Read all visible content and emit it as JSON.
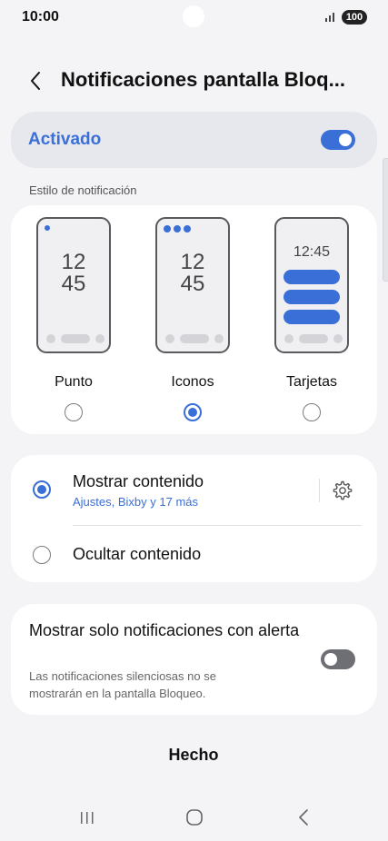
{
  "status_bar": {
    "time": "10:00",
    "battery": "100"
  },
  "header": {
    "title": "Notificaciones pantalla Bloq..."
  },
  "master_toggle": {
    "label": "Activado",
    "state": "on"
  },
  "style_section": {
    "label": "Estilo de notificación",
    "options": [
      {
        "label": "Punto",
        "clock_hour": "12",
        "clock_min": "45",
        "selected": false
      },
      {
        "label": "Iconos",
        "clock_hour": "12",
        "clock_min": "45",
        "selected": true
      },
      {
        "label": "Tarjetas",
        "clock": "12:45",
        "selected": false
      }
    ]
  },
  "content_section": {
    "show": {
      "label": "Mostrar contenido",
      "sublabel": "Ajustes, Bixby y 17 más",
      "selected": true
    },
    "hide": {
      "label": "Ocultar contenido",
      "selected": false
    }
  },
  "alert_section": {
    "title": "Mostrar solo notificaciones con alerta",
    "description": "Las notificaciones silenciosas no se mostrarán en la pantalla Bloqueo.",
    "state": "off"
  },
  "done_label": "Hecho",
  "colors": {
    "accent": "#3a6fd8",
    "background": "#f4f4f6",
    "card": "#ffffff"
  },
  "icons": {
    "back": "chevron-left-icon",
    "settings": "gear-icon",
    "nav_recents": "recents-icon",
    "nav_home": "home-icon",
    "nav_back": "back-icon"
  }
}
